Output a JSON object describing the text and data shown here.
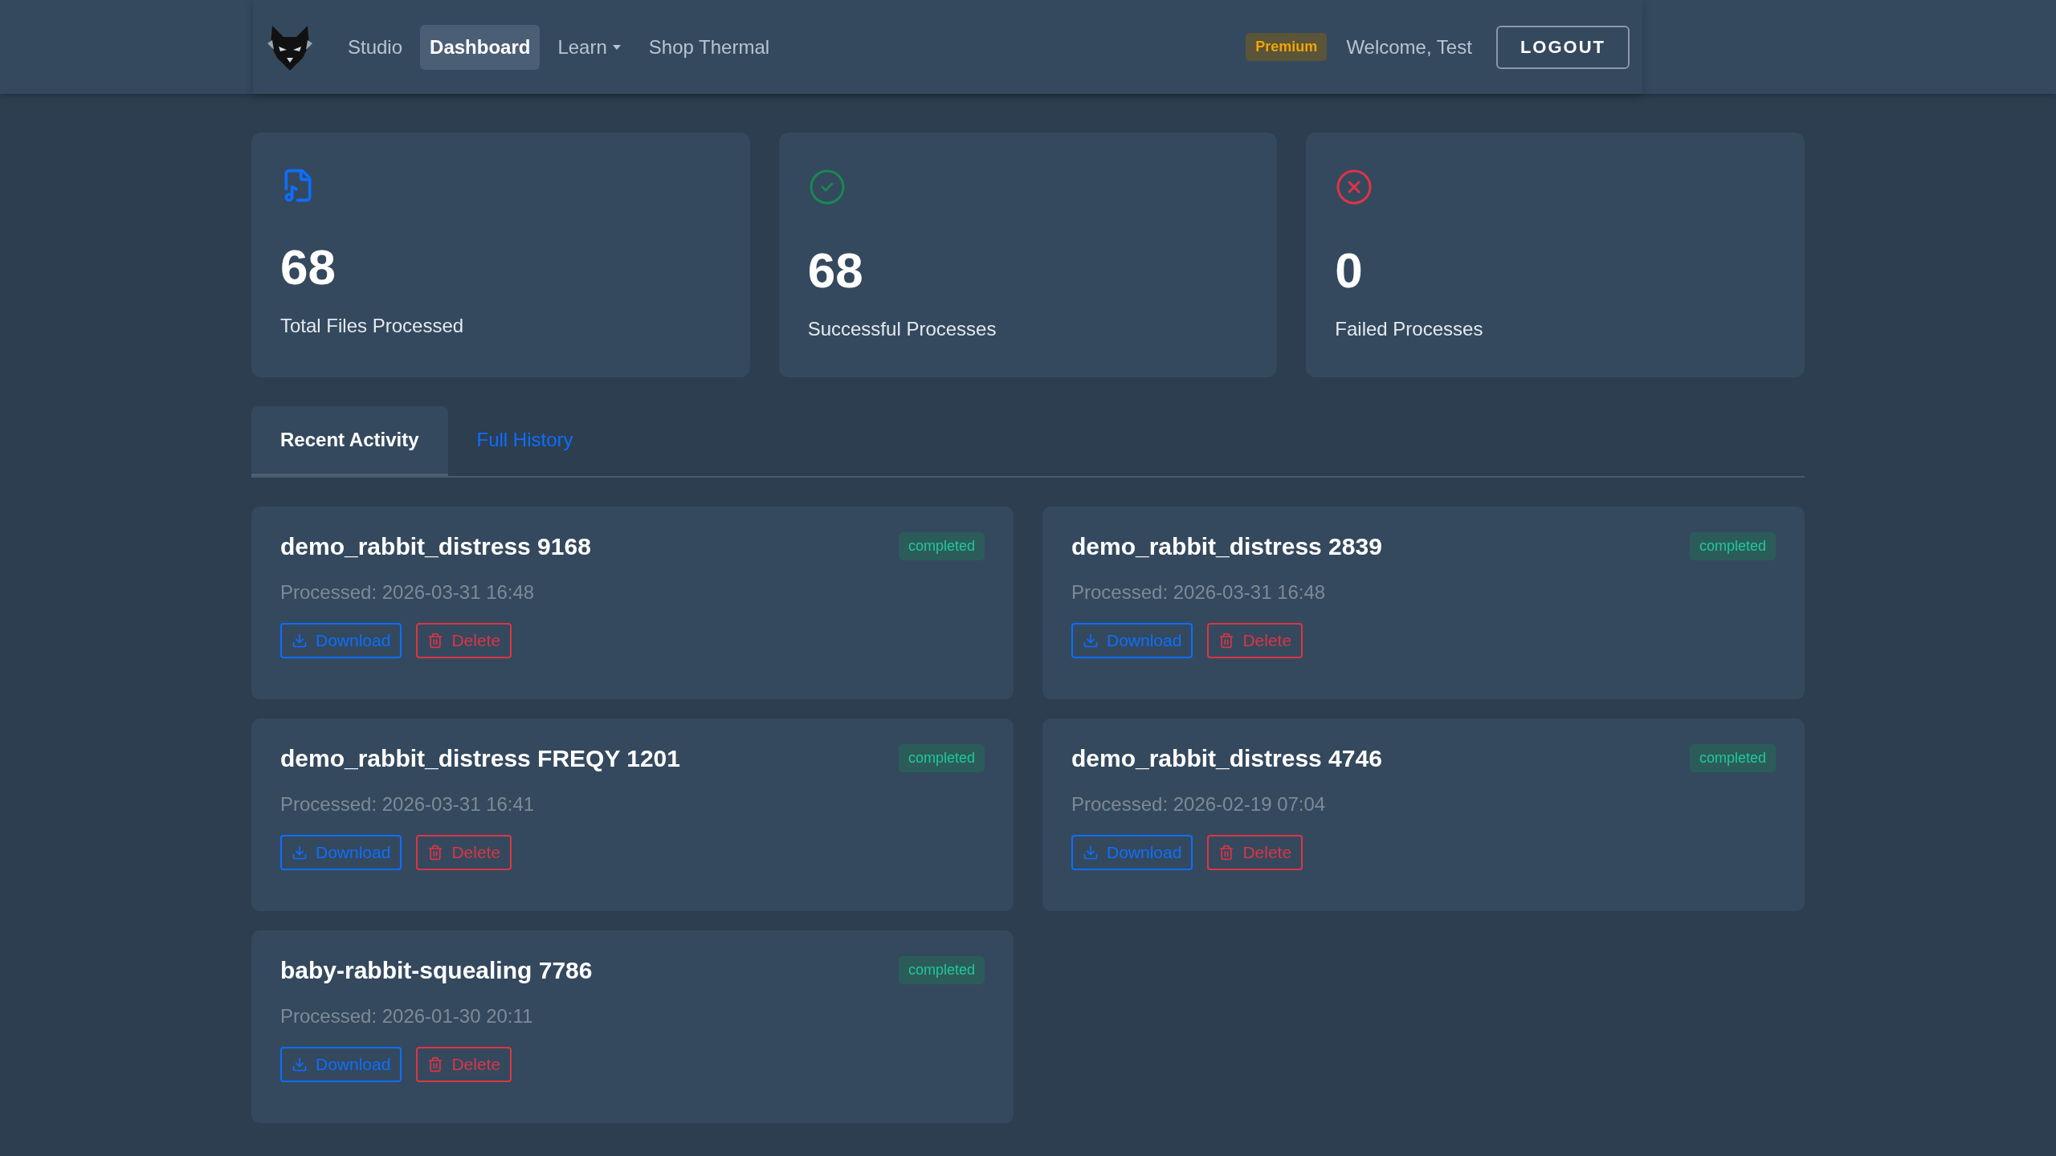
{
  "navbar": {
    "links": [
      {
        "label": "Studio",
        "selected": false,
        "dropdown": false
      },
      {
        "label": "Dashboard",
        "selected": true,
        "dropdown": false
      },
      {
        "label": "Learn",
        "selected": false,
        "dropdown": true
      },
      {
        "label": "Shop Thermal",
        "selected": false,
        "dropdown": false
      }
    ],
    "plan_badge": "Premium",
    "welcome": "Welcome, Test",
    "logout_button": "LOGOUT"
  },
  "stats": [
    {
      "kind": "file",
      "value": "68",
      "label": "Total Files Processed"
    },
    {
      "kind": "success",
      "value": "68",
      "label": "Successful Processes"
    },
    {
      "kind": "failed",
      "value": "0",
      "label": "Failed Processes"
    }
  ],
  "tabs": [
    {
      "label": "Recent Activity",
      "selected": true
    },
    {
      "label": "Full History",
      "selected": false
    }
  ],
  "activity": [
    {
      "name": "demo_rabbit_distress 9168",
      "status": "completed",
      "processed": "Processed: 2026-03-31 16:48",
      "download": "Download",
      "delete": "Delete"
    },
    {
      "name": "demo_rabbit_distress 2839",
      "status": "completed",
      "processed": "Processed: 2026-03-31 16:48",
      "download": "Download",
      "delete": "Delete"
    },
    {
      "name": "demo_rabbit_distress FREQY 1201",
      "status": "completed",
      "processed": "Processed: 2026-03-31 16:41",
      "download": "Download",
      "delete": "Delete"
    },
    {
      "name": "demo_rabbit_distress 4746",
      "status": "completed",
      "processed": "Processed: 2026-02-19 07:04",
      "download": "Download",
      "delete": "Delete"
    },
    {
      "name": "baby-rabbit-squealing 7786",
      "status": "completed",
      "processed": "Processed: 2026-01-30 20:11",
      "download": "Download",
      "delete": "Delete"
    }
  ]
}
